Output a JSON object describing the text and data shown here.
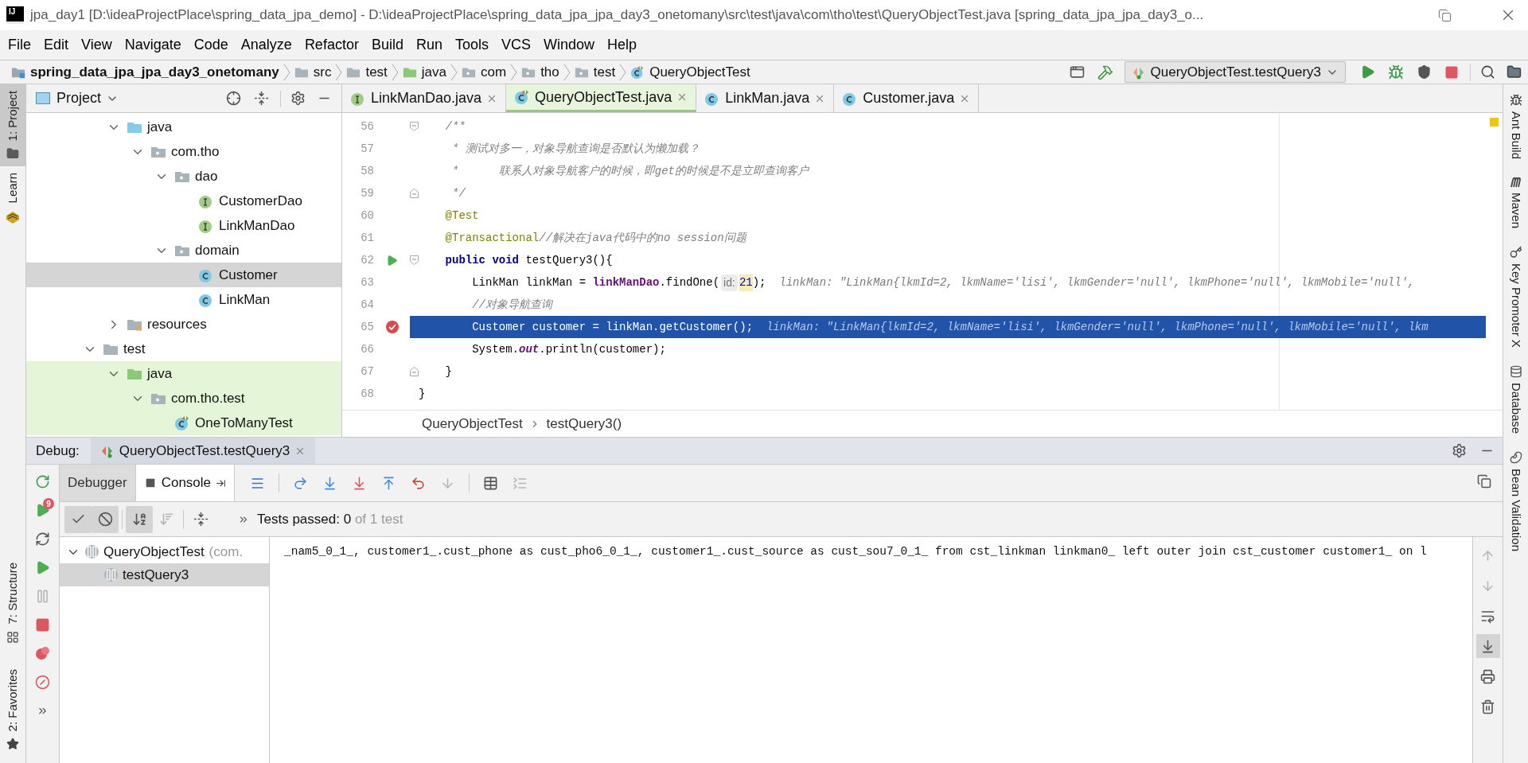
{
  "window": {
    "logo": "IJ",
    "title": "jpa_day1 [D:\\ideaProjectPlace\\spring_data_jpa_demo] - D:\\ideaProjectPlace\\spring_data_jpa_jpa_day3_onetomany\\src\\test\\java\\com\\tho\\test\\QueryObjectTest.java [spring_data_jpa_jpa_day3_o..."
  },
  "menu": [
    "File",
    "Edit",
    "View",
    "Navigate",
    "Code",
    "Analyze",
    "Refactor",
    "Build",
    "Run",
    "Tools",
    "VCS",
    "Window",
    "Help"
  ],
  "breadcrumbs": [
    {
      "label": "spring_data_jpa_jpa_day3_onetomany",
      "kind": "module"
    },
    {
      "label": "src",
      "kind": "folder"
    },
    {
      "label": "test",
      "kind": "folder"
    },
    {
      "label": "java",
      "kind": "test-source-folder"
    },
    {
      "label": "com",
      "kind": "package"
    },
    {
      "label": "tho",
      "kind": "package"
    },
    {
      "label": "test",
      "kind": "package"
    },
    {
      "label": "QueryObjectTest",
      "kind": "test-class"
    }
  ],
  "run_config": "QueryObjectTest.testQuery3",
  "left_tools_top": [
    {
      "label": "1: Project",
      "kind": "folder",
      "selected": true
    },
    {
      "label": "Learn",
      "kind": "learn",
      "selected": false
    }
  ],
  "left_tools_bottom": [
    {
      "label": "7: Structure",
      "kind": "structure"
    },
    {
      "label": "2: Favorites",
      "kind": "star"
    }
  ],
  "right_tools": [
    {
      "label": "Ant Build",
      "kind": "ant"
    },
    {
      "label": "Maven",
      "kind": "maven"
    },
    {
      "label": "Key Promoter X",
      "kind": "key"
    },
    {
      "label": "Database",
      "kind": "database"
    },
    {
      "label": "Bean Validation",
      "kind": "bean"
    }
  ],
  "project_panel": {
    "title": "Project",
    "tree": [
      {
        "children": [
          {
            "label": "java",
            "kind": "source-folder",
            "expanded": true,
            "selected": false,
            "children": [
              {
                "label": "com.tho",
                "kind": "package",
                "expanded": true,
                "selected": false,
                "children": [
                  {
                    "label": "dao",
                    "kind": "package",
                    "expanded": true,
                    "selected": false,
                    "children": [
                      {
                        "label": "CustomerDao",
                        "kind": "interface",
                        "selected": false
                      },
                      {
                        "label": "LinkManDao",
                        "kind": "interface",
                        "selected": false
                      }
                    ]
                  },
                  {
                    "label": "domain",
                    "kind": "package",
                    "expanded": true,
                    "selected": false,
                    "children": [
                      {
                        "label": "Customer",
                        "kind": "class",
                        "selected": true
                      },
                      {
                        "label": "LinkMan",
                        "kind": "class",
                        "selected": false
                      }
                    ]
                  }
                ]
              }
            ]
          },
          {
            "label": "resources",
            "kind": "resource-folder",
            "expanded": false,
            "selected": false
          }
        ]
      },
      {
        "label": "test",
        "kind": "folder",
        "expanded": true,
        "selected": false,
        "children": [
          {
            "label": "java",
            "kind": "test-source-folder",
            "expanded": true,
            "selected": false,
            "children": [
              {
                "label": "com.tho.test",
                "kind": "package",
                "expanded": true,
                "selected": false,
                "children": [
                  {
                    "label": "OneToManyTest",
                    "kind": "test-class",
                    "selected": false
                  }
                ]
              }
            ]
          }
        ]
      }
    ]
  },
  "editor_tabs": [
    {
      "label": "LinkManDao.java",
      "kind": "interface",
      "selected": false
    },
    {
      "label": "QueryObjectTest.java",
      "kind": "test-class",
      "selected": true
    },
    {
      "label": "LinkMan.java",
      "kind": "class",
      "selected": false
    },
    {
      "label": "Customer.java",
      "kind": "class",
      "selected": false
    }
  ],
  "code_lines": [
    {
      "number": "56",
      "fold_start": true,
      "current": false,
      "segments": [
        {
          "kind": "comment",
          "text": "    /**"
        }
      ]
    },
    {
      "number": "57",
      "current": false,
      "segments": [
        {
          "kind": "comment",
          "text": "     * 测试对多一，对象导航查询是否默认为懒加载？"
        }
      ]
    },
    {
      "number": "58",
      "current": false,
      "segments": [
        {
          "kind": "comment",
          "text": "     *      联系人对象导航客户的时候，即get的时候是不是立即查询客户"
        }
      ]
    },
    {
      "number": "59",
      "fold_end": true,
      "current": false,
      "segments": [
        {
          "kind": "comment",
          "text": "     */"
        }
      ]
    },
    {
      "number": "60",
      "current": false,
      "segments": [
        {
          "kind": "annotation",
          "text": "    @Test"
        }
      ]
    },
    {
      "number": "61",
      "current": false,
      "segments": [
        {
          "kind": "annotation",
          "text": "    @Transactional"
        },
        {
          "kind": "comment",
          "text": "//解决在java代码中的no session问题"
        }
      ]
    },
    {
      "number": "62",
      "fold_start": true,
      "run_marker": true,
      "current": false,
      "segments": [
        {
          "kind": "keyword",
          "text": "    public void"
        },
        {
          "kind": "plain",
          "text": " testQuery3(){"
        }
      ]
    },
    {
      "number": "63",
      "current": false,
      "segments": [
        {
          "kind": "plain",
          "text": "        LinkMan linkMan = "
        },
        {
          "kind": "field",
          "text": "linkManDao"
        },
        {
          "kind": "plain",
          "text": ".findOne("
        },
        {
          "kind": "param-hint",
          "text": "id:"
        },
        {
          "kind": "value-highlight",
          "text": "21"
        },
        {
          "kind": "plain",
          "text": ");"
        },
        {
          "kind": "hint",
          "text": "  linkMan: \"LinkMan{lkmId=2, lkmName='lisi', lkmGender='null', lkmPhone='null', lkmMobile='null',"
        }
      ]
    },
    {
      "number": "64",
      "current": false,
      "segments": [
        {
          "kind": "comment",
          "text": "        //对象导航查询"
        }
      ]
    },
    {
      "number": "65",
      "breakpoint": true,
      "current": true,
      "segments": [
        {
          "kind": "plain",
          "text": "        Customer customer = linkMan.getCustomer();"
        },
        {
          "kind": "hint",
          "text": "  linkMan: \"LinkMan{lkmId=2, lkmName='lisi', lkmGender='null', lkmPhone='null', lkmMobile='null', lkm"
        }
      ]
    },
    {
      "number": "66",
      "current": false,
      "segments": [
        {
          "kind": "plain",
          "text": "        System."
        },
        {
          "kind": "static",
          "text": "out"
        },
        {
          "kind": "plain",
          "text": ".println(customer);"
        }
      ]
    },
    {
      "number": "67",
      "fold_end": true,
      "current": false,
      "segments": [
        {
          "kind": "plain",
          "text": "    }"
        }
      ]
    },
    {
      "number": "68",
      "current": false,
      "segments": [
        {
          "kind": "plain",
          "text": "}"
        }
      ]
    }
  ],
  "editor_breadcrumbs": [
    "QueryObjectTest",
    "testQuery3()"
  ],
  "debug": {
    "label": "Debug:",
    "session": "QueryObjectTest.testQuery3",
    "actions": [
      {
        "kind": "rerun",
        "disabled": false
      },
      {
        "kind": "rerun-failed",
        "badge": "9",
        "disabled": false
      },
      {
        "kind": "restore",
        "disabled": false
      },
      {
        "kind": "resume",
        "disabled": false
      },
      {
        "kind": "pause",
        "disabled": true
      },
      {
        "kind": "stop",
        "disabled": false
      },
      {
        "kind": "breakpoints",
        "disabled": false
      },
      {
        "kind": "mute",
        "disabled": false
      },
      {
        "kind": "more",
        "disabled": false
      }
    ],
    "tabs": [
      {
        "label": "Debugger",
        "kind": "debugger",
        "selected": false
      },
      {
        "label": "Console",
        "kind": "console",
        "selected": true
      }
    ],
    "toolbar_groups": [
      [
        {
          "kind": "layout",
          "disabled": false
        }
      ],
      [
        {
          "kind": "step-over",
          "disabled": false
        },
        {
          "kind": "step-into",
          "disabled": false
        },
        {
          "kind": "force-step-into",
          "disabled": false
        },
        {
          "kind": "step-out",
          "disabled": false
        },
        {
          "kind": "drop-frame",
          "disabled": false
        },
        {
          "kind": "run-to-cursor",
          "disabled": true
        }
      ],
      [
        {
          "kind": "evaluate",
          "disabled": false
        },
        {
          "kind": "trace",
          "disabled": true
        }
      ]
    ],
    "test_toolbar": [
      {
        "kind": "show-passed",
        "pressed": true,
        "disabled": false
      },
      {
        "kind": "show-ignored",
        "pressed": true,
        "disabled": false
      },
      {
        "kind": "sort-alpha",
        "pressed": true,
        "disabled": false
      },
      {
        "kind": "sort-duration",
        "pressed": false,
        "disabled": true
      },
      {
        "kind": "collapse",
        "pressed": false,
        "disabled": false
      }
    ],
    "status": {
      "label": "Tests passed:",
      "passed": "0",
      "total": "of 1 test"
    },
    "tests": [
      {
        "label": "QueryObjectTest",
        "detail": "(com.",
        "selected": false,
        "expanded": true,
        "children": [
          {
            "label": "testQuery3",
            "selected": true
          }
        ]
      }
    ],
    "console_lines": [
      "_nam5_0_1_, customer1_.cust_phone as cust_pho6_0_1_, customer1_.cust_source as cust_sou7_0_1_ from cst_linkman linkman0_ left outer join cst_customer customer1_ on l"
    ],
    "console_tools": [
      {
        "kind": "up",
        "pressed": false,
        "disabled": true
      },
      {
        "kind": "down",
        "pressed": false,
        "disabled": true
      },
      {
        "kind": "wrap",
        "pressed": false,
        "disabled": false
      },
      {
        "kind": "scroll-end",
        "pressed": true,
        "disabled": false
      },
      {
        "kind": "print",
        "pressed": false,
        "disabled": false
      },
      {
        "kind": "clear",
        "pressed": false,
        "disabled": false
      }
    ]
  }
}
